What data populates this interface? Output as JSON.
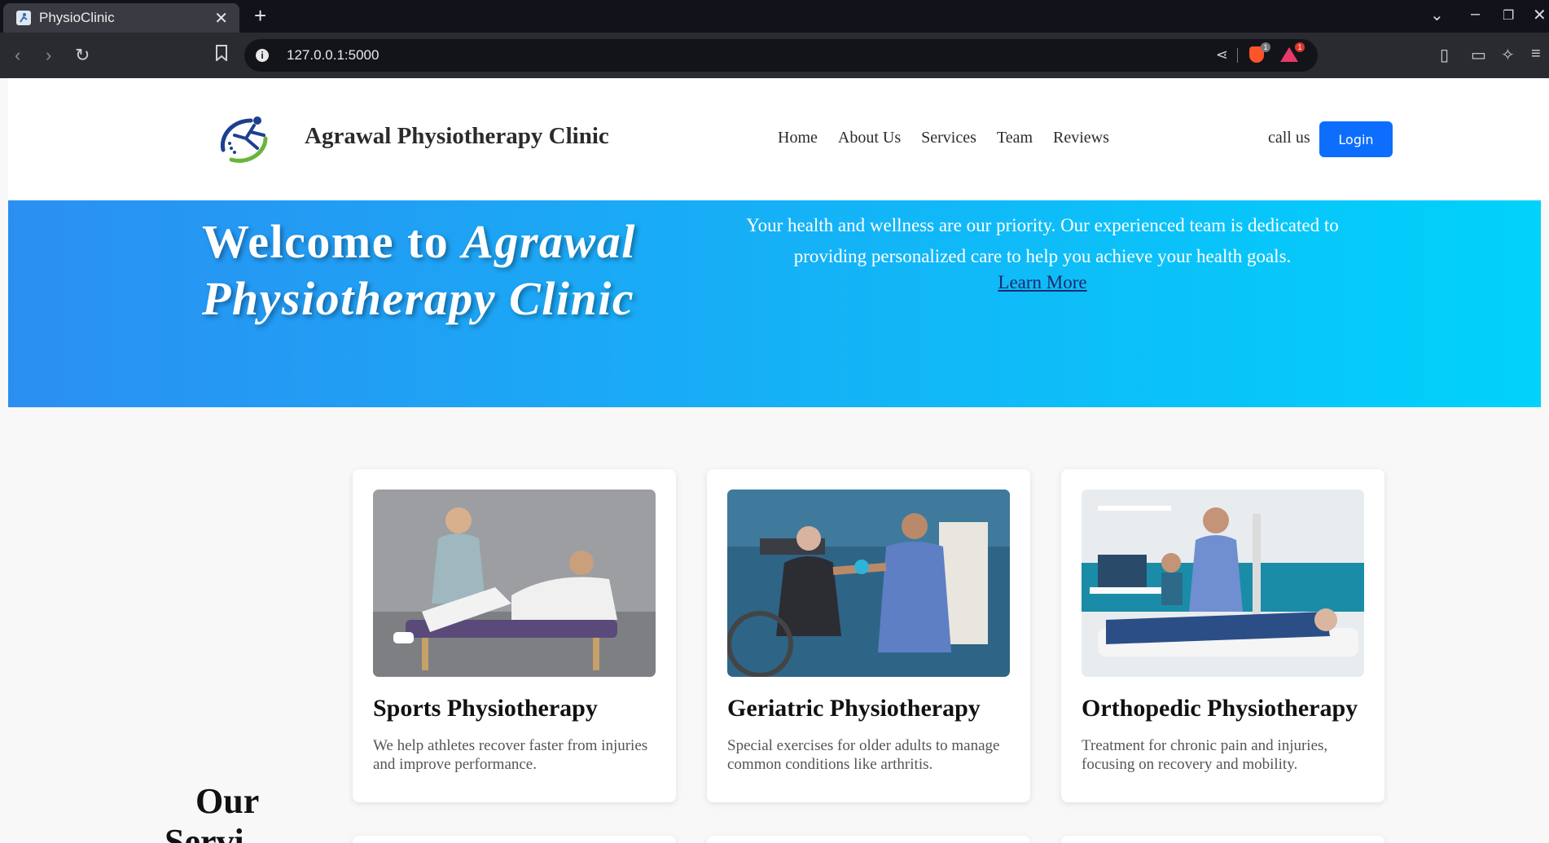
{
  "browser": {
    "tab_title": "PhysioClinic",
    "url": "127.0.0.1:5000",
    "brave_badge": "1",
    "rewards_badge": "1"
  },
  "header": {
    "brand": "Agrawal Physiotherapy Clinic",
    "nav": [
      "Home",
      "About Us",
      "Services",
      "Team",
      "Reviews"
    ],
    "call_us": "call us",
    "login": "Login"
  },
  "hero": {
    "title_plain": "Welcome to ",
    "title_italic": "Agrawal Physiotherapy Clinic",
    "text": "Your health and wellness are our priority. Our experienced team is dedicated to providing personalized care to help you achieve your health goals.",
    "link": "Learn More"
  },
  "services": {
    "section_title_line1": "Our",
    "section_title_line2": "Servi",
    "cards": [
      {
        "title": "Sports Physiotherapy",
        "desc": "We help athletes recover faster from injuries and improve performance."
      },
      {
        "title": "Geriatric Physiotherapy",
        "desc": "Special exercises for older adults to manage common conditions like arthritis."
      },
      {
        "title": "Orthopedic Physiotherapy",
        "desc": "Treatment for chronic pain and injuries, focusing on recovery and mobility."
      }
    ]
  },
  "colors": {
    "hero_start": "#2b8ff2",
    "hero_end": "#00d2fb",
    "login_button": "#0d6efd"
  }
}
